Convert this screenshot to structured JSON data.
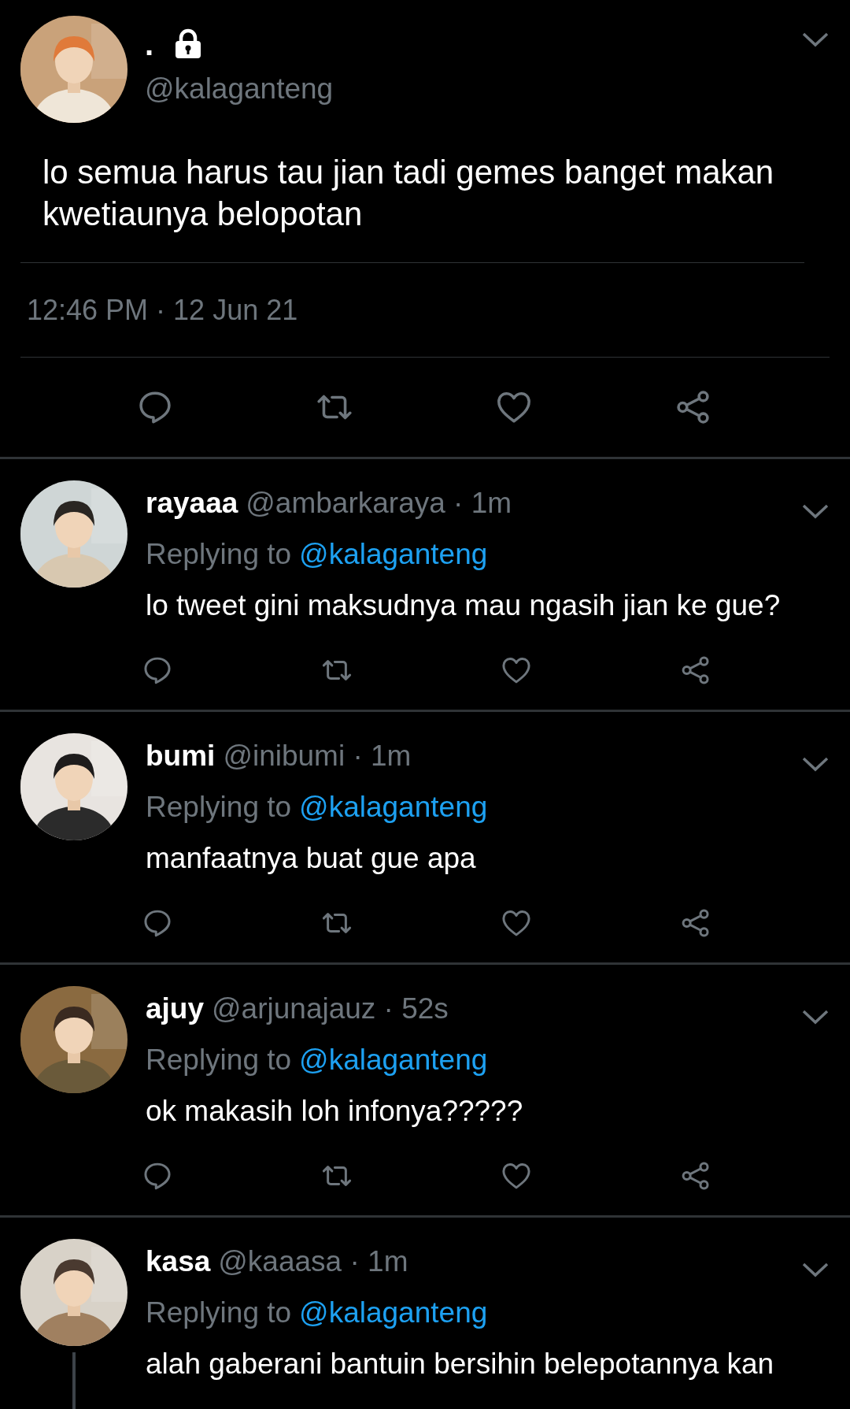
{
  "tweet": {
    "name": ".",
    "locked": true,
    "handle": "@kalaganteng",
    "text": "lo semua harus tau jian tadi gemes banget makan kwetiaunya belopotan",
    "timestamp": "12:46 PM · 12 Jun 21"
  },
  "replies": [
    {
      "name": "rayaaa",
      "meta": "@ambarkaraya · 1m",
      "replying_label": "Replying to",
      "replying_to": "@kalaganteng",
      "text": "lo tweet gini maksudnya mau ngasih jian ke gue?",
      "thread": false,
      "actions": true
    },
    {
      "name": "bumi",
      "meta": "@inibumi · 1m",
      "replying_label": "Replying to",
      "replying_to": "@kalaganteng",
      "text": "manfaatnya buat gue apa",
      "thread": false,
      "actions": true
    },
    {
      "name": "ajuy",
      "meta": "@arjunajauz · 52s",
      "replying_label": "Replying to",
      "replying_to": "@kalaganteng",
      "text": "ok makasih loh infonya?????",
      "thread": false,
      "actions": true
    },
    {
      "name": "kasa",
      "meta": "@kaaasa · 1m",
      "replying_label": "Replying to",
      "replying_to": "@kalaganteng",
      "text": "alah gaberani bantuin bersihin belepotannya kan",
      "thread": true,
      "actions": false
    }
  ]
}
